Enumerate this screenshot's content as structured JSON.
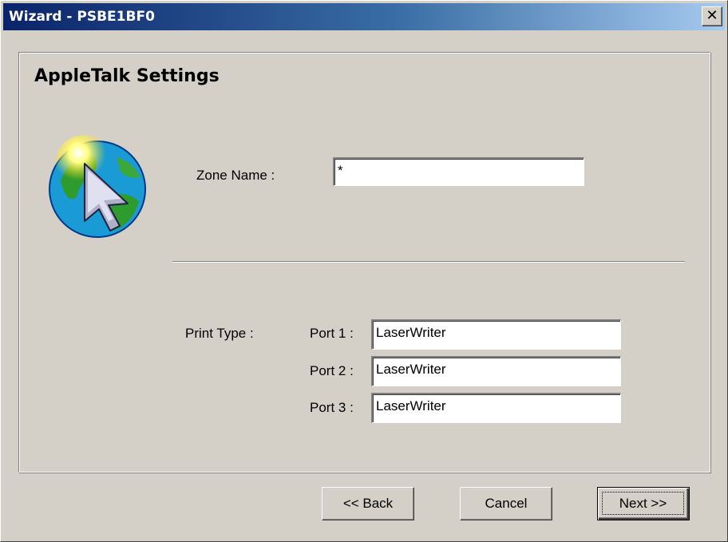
{
  "window": {
    "title": "Wizard - PSBE1BF0",
    "close_glyph": "✕"
  },
  "panel": {
    "title": "AppleTalk Settings",
    "icon": "appletalk-globe-pointer-icon"
  },
  "zone": {
    "label": "Zone Name :",
    "value": "*"
  },
  "print": {
    "label": "Print Type :",
    "ports": [
      {
        "label": "Port 1 :",
        "value": "LaserWriter"
      },
      {
        "label": "Port 2 :",
        "value": "LaserWriter"
      },
      {
        "label": "Port 3 :",
        "value": "LaserWriter"
      }
    ]
  },
  "buttons": {
    "back": "<< Back",
    "cancel": "Cancel",
    "next": "Next >>"
  },
  "colors": {
    "face": "#d4d0c8",
    "title_start": "#0a246a",
    "title_end": "#a6caf0"
  }
}
